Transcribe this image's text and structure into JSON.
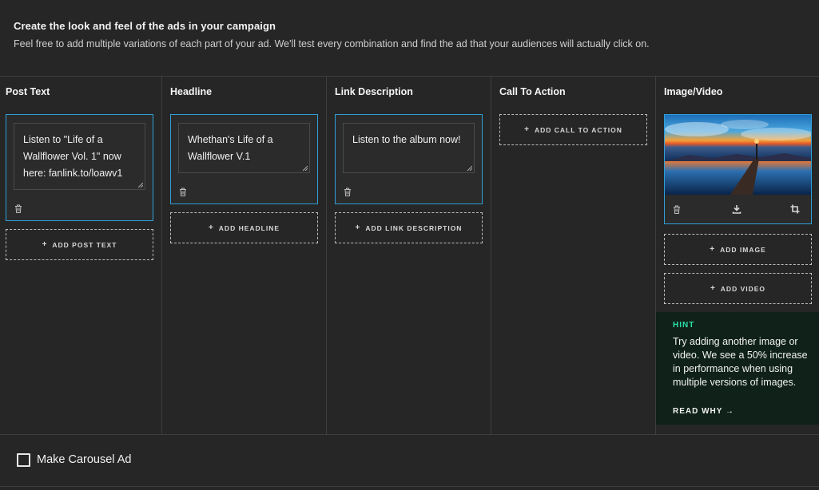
{
  "header": {
    "title": "Create the look and feel of the ads in your campaign",
    "subtitle": "Feel free to add multiple variations of each part of your ad. We'll test every combination and find the ad that your audiences will actually click on."
  },
  "columns": {
    "post_text": {
      "title": "Post Text",
      "value": "Listen to \"Life of a Wallflower Vol. 1\" now here: fanlink.to/loawv1",
      "add_label": "ADD POST TEXT"
    },
    "headline": {
      "title": "Headline",
      "value": "Whethan's Life of a Wallflower V.1",
      "add_label": "ADD HEADLINE"
    },
    "link_description": {
      "title": "Link Description",
      "value": "Listen to the album now!",
      "add_label": "ADD LINK DESCRIPTION"
    },
    "call_to_action": {
      "title": "Call To Action",
      "add_label": "ADD CALL TO ACTION"
    },
    "image_video": {
      "title": "Image/Video",
      "add_image_label": "ADD IMAGE",
      "add_video_label": "ADD VIDEO"
    }
  },
  "hint": {
    "label": "HINT",
    "text": "Try adding another image or video. We see a 50% increase in performance when using multiple versions of images.",
    "link": "READ WHY →"
  },
  "carousel": {
    "label": "Make Carousel Ad",
    "checked": false
  },
  "icons": {
    "trash": "trash-icon",
    "download": "download-icon",
    "crop": "crop-icon",
    "plus": "plus-icon"
  },
  "colors": {
    "background": "#262626",
    "accent_border": "#2f9fd8",
    "hint_bg": "#0f2119",
    "hint_accent": "#2be0a8"
  }
}
